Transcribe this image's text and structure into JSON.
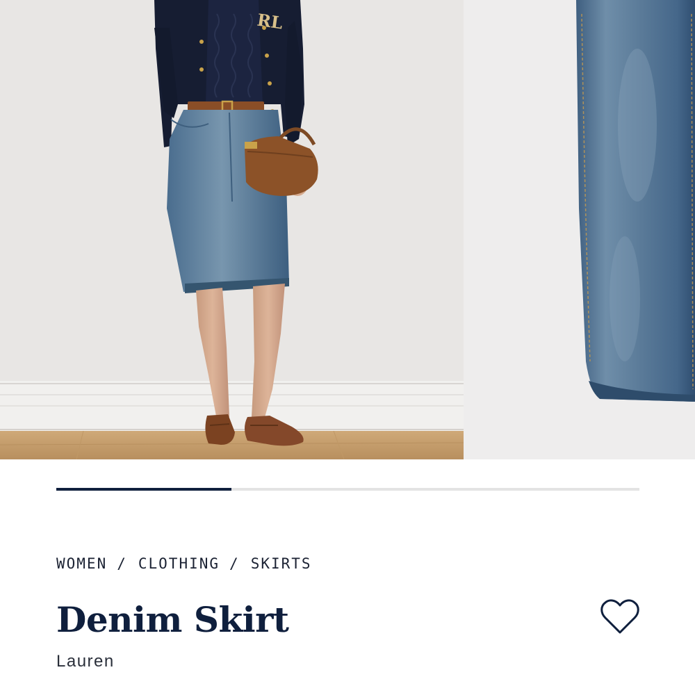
{
  "gallery": {
    "images": [
      {
        "icon": "model-wearing-denim-skirt-photo",
        "type": "lifestyle"
      },
      {
        "icon": "denim-skirt-closeup-photo",
        "type": "detail"
      }
    ],
    "progress": {
      "current": 1,
      "total": 3,
      "fraction": 0.3
    },
    "colors": {
      "track": "#e3e3e3",
      "fill": "#0f1f3d"
    }
  },
  "breadcrumb": {
    "items": [
      "WOMEN",
      "CLOTHING",
      "SKIRTS"
    ],
    "separator": "/"
  },
  "product": {
    "title": "Denim Skirt",
    "brand": "Lauren"
  },
  "wishlist": {
    "icon": "heart-icon"
  },
  "colors": {
    "navy": "#0f1f3d",
    "text": "#1b2233"
  }
}
